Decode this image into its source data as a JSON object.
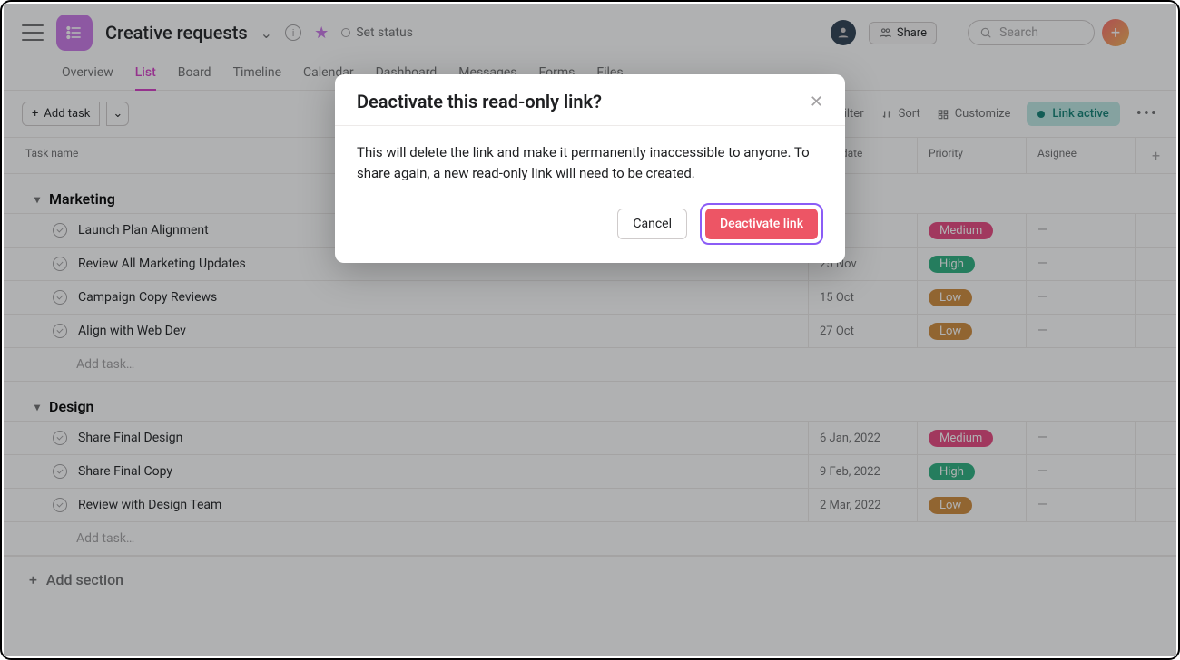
{
  "header": {
    "project_title": "Creative requests",
    "set_status": "Set status",
    "share_label": "Share",
    "search_placeholder": "Search"
  },
  "tabs": [
    "Overview",
    "List",
    "Board",
    "Timeline",
    "Calendar",
    "Dashboard",
    "Messages",
    "Forms",
    "Files"
  ],
  "active_tab_index": 1,
  "toolbar": {
    "add_task": "Add task",
    "filter": "Filter",
    "sort": "Sort",
    "customize": "Customize",
    "link_active": "Link active"
  },
  "columns": [
    "Task name",
    "Due date",
    "Priority",
    "Asignee"
  ],
  "sections": [
    {
      "name": "Marketing",
      "rows": [
        {
          "task": "Launch Plan Alignment",
          "due": "",
          "priority": "Medium",
          "assignee": "—"
        },
        {
          "task": "Review All Marketing Updates",
          "due": "25 Nov",
          "priority": "High",
          "assignee": "—"
        },
        {
          "task": "Campaign Copy Reviews",
          "due": "15 Oct",
          "priority": "Low",
          "assignee": "—"
        },
        {
          "task": "Align with Web Dev",
          "due": "27 Oct",
          "priority": "Low",
          "assignee": "—"
        }
      ],
      "add_task_label": "Add task…"
    },
    {
      "name": "Design",
      "rows": [
        {
          "task": "Share Final Design",
          "due": "6 Jan, 2022",
          "priority": "Medium",
          "assignee": "—"
        },
        {
          "task": "Share Final Copy",
          "due": "9 Feb, 2022",
          "priority": "High",
          "assignee": "—"
        },
        {
          "task": "Review with Design Team",
          "due": "2 Mar, 2022",
          "priority": "Low",
          "assignee": "—"
        }
      ],
      "add_task_label": "Add task…"
    }
  ],
  "add_section_label": "Add section",
  "modal": {
    "title": "Deactivate this read-only link?",
    "body": "This will delete the link and make it permanently inaccessible to anyone. To share again, a new read-only link will need to be created.",
    "cancel": "Cancel",
    "confirm": "Deactivate link"
  }
}
